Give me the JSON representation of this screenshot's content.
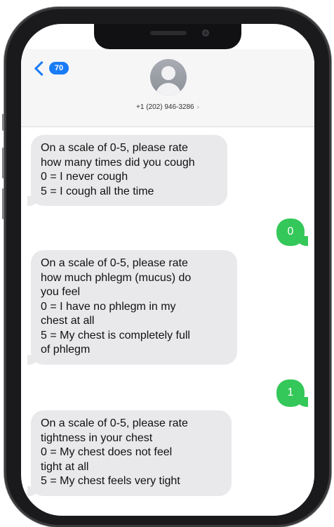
{
  "header": {
    "back_badge": "70",
    "contact_number": "+1 (202) 946-3286",
    "contact_chevron": "›"
  },
  "messages": [
    {
      "direction": "incoming",
      "lines": [
        "On a scale of 0-5, please rate",
        "how many times did you cough",
        "0 = I never cough",
        "5 = I cough all the time"
      ]
    },
    {
      "direction": "outgoing",
      "text": "0"
    },
    {
      "direction": "incoming",
      "lines": [
        "On a scale of 0-5, please rate",
        "how much phlegm (mucus) do",
        "you feel",
        "0 =  I have no phlegm in my",
        "chest at all",
        "5 =  My chest is completely full",
        "of phlegm"
      ]
    },
    {
      "direction": "outgoing",
      "text": "1"
    },
    {
      "direction": "incoming",
      "lines": [
        "On a scale of 0-5, please rate",
        "tightness in your chest",
        "0 =  My chest does not feel",
        "tight at all",
        "5 =  My chest feels very tight"
      ]
    }
  ],
  "colors": {
    "incoming_bubble": "#e9e9eb",
    "outgoing_bubble": "#34c759",
    "accent": "#1a7cf5"
  },
  "icons": {
    "back": "chevron-left-icon",
    "avatar": "person-avatar-icon"
  }
}
